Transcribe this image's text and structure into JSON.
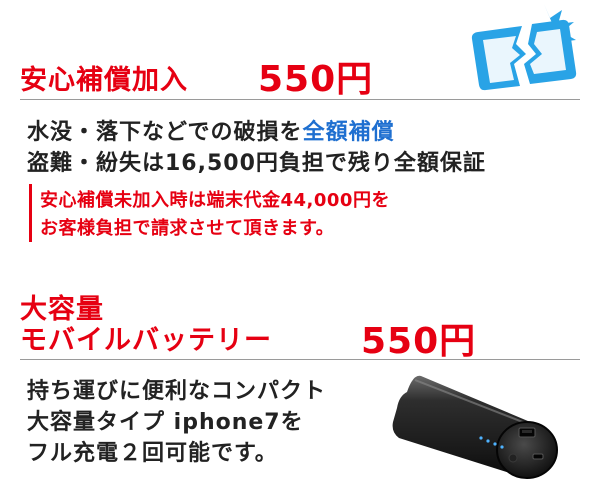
{
  "insurance": {
    "title": "安心補償加入",
    "price": "550円",
    "line1_pre": "水没・落下などでの破損を",
    "line1_highlight": "全額補償",
    "line2": "盗難・紛失は16,500円負担で残り全額保証",
    "note_line1": "安心補償未加入時は端末代金44,000円を",
    "note_line2": "お客様負担で請求させて頂きます。"
  },
  "battery": {
    "title_line1": "大容量",
    "title_line2": "モバイルバッテリー",
    "price": "550円",
    "desc_line1": "持ち運びに便利なコンパクト",
    "desc_line2": "大容量タイプ iphone7を",
    "desc_line3": "フル充電２回可能です。"
  },
  "colors": {
    "accent_red": "#e60012",
    "highlight_blue": "#1e6fd0",
    "icon_blue": "#29a3e6",
    "text_dark": "#222222"
  },
  "icons": {
    "insurance": "broken-phone-icon",
    "battery": "power-bank-image"
  }
}
